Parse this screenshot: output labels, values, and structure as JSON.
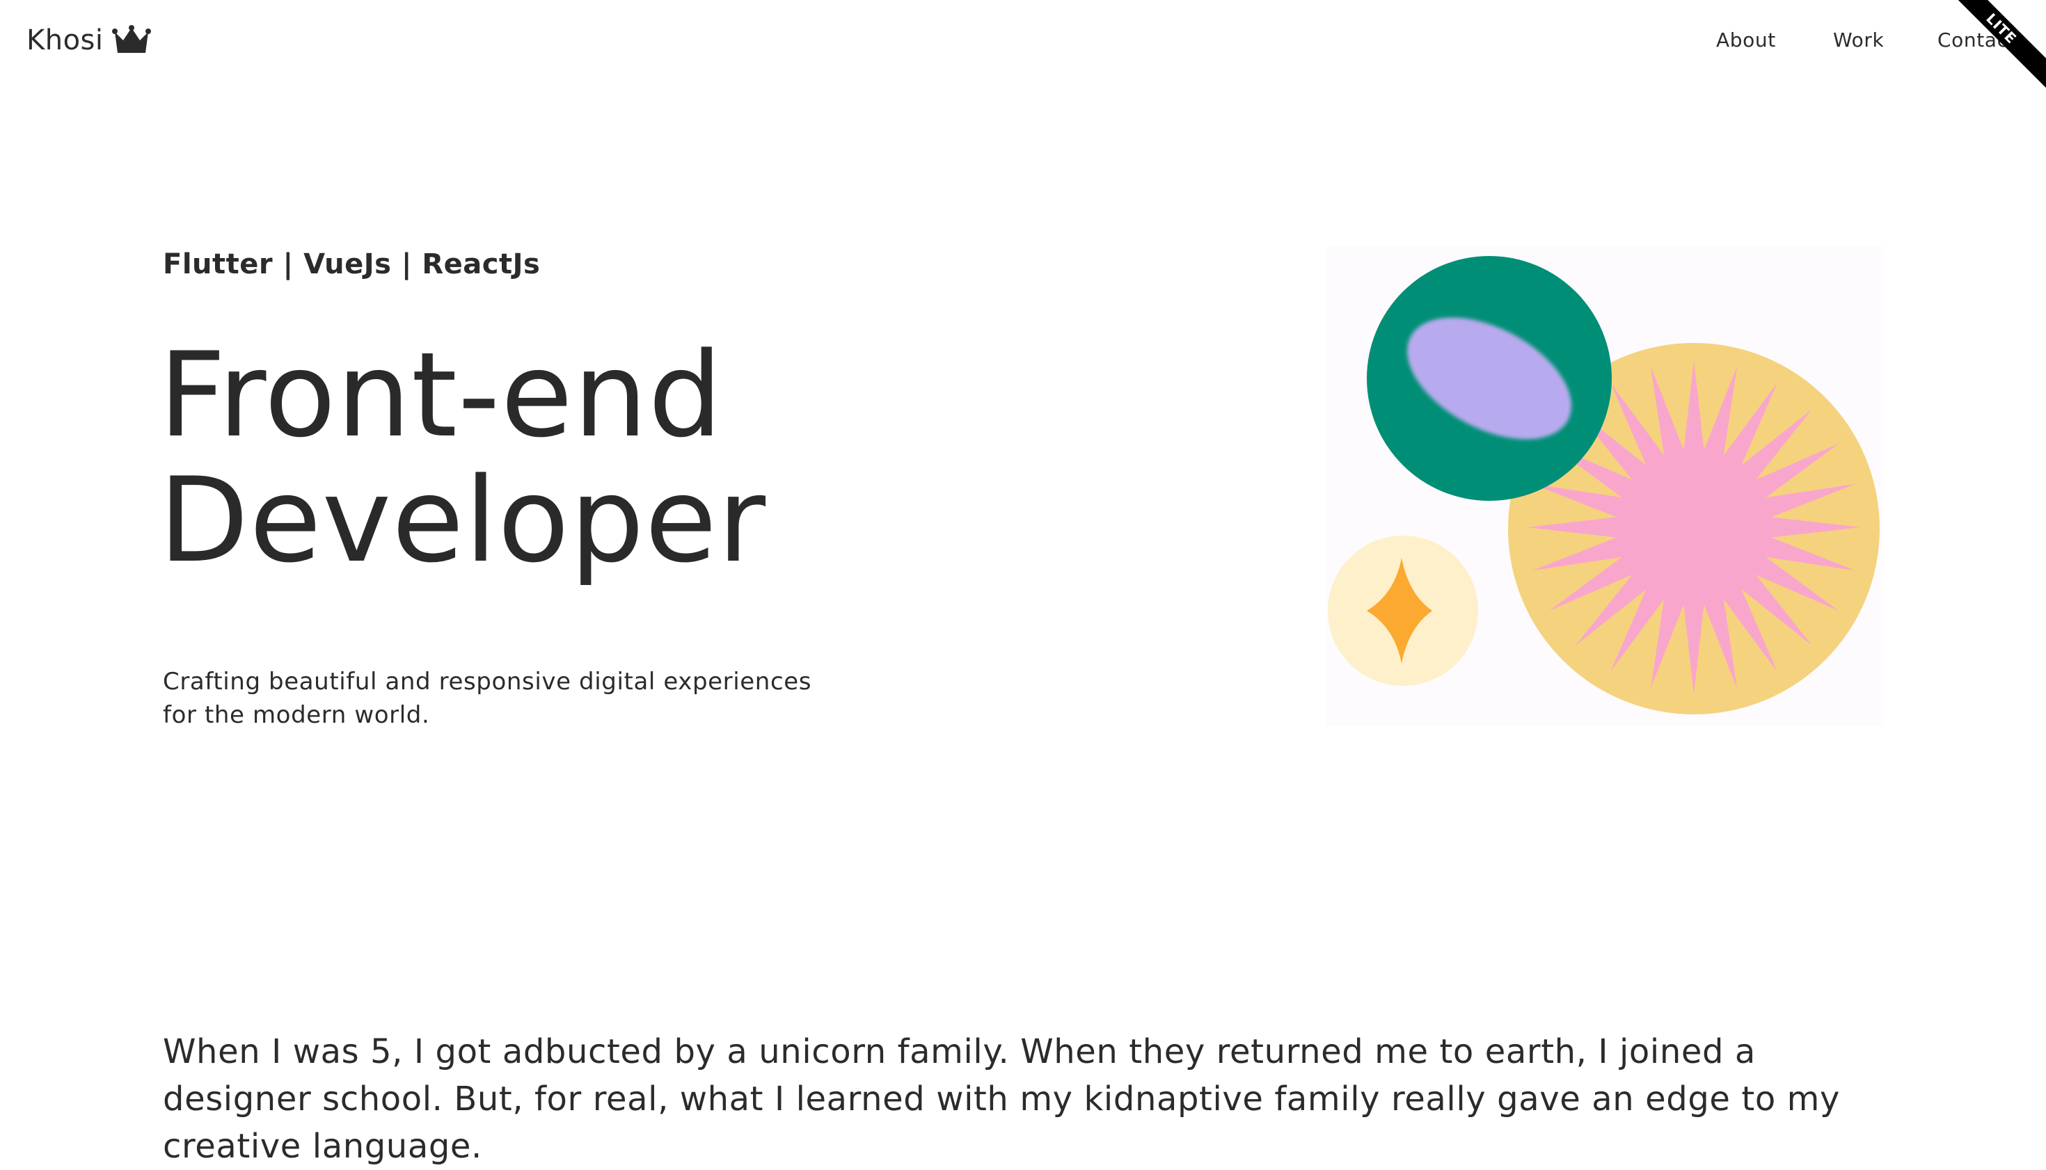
{
  "nav": {
    "brand": "Khosi",
    "brand_icon": "crown-icon",
    "links": [
      "About",
      "Work",
      "Contact"
    ],
    "ribbon": "LITE"
  },
  "hero": {
    "tags": "Flutter | VueJs | ReactJs",
    "title_line1": "Front-end",
    "title_line2": "Developer",
    "subtitle_line1": "Crafting beautiful and responsive digital experiences",
    "subtitle_line2": "for the modern world."
  },
  "about": {
    "text": "When I was 5, I got adbucted by a unicorn family. When they returned me to earth, I joined a designer school. But, for real, what I learned with my kidnaptive family really gave an edge to my creative language."
  },
  "colors": {
    "text": "#2b2b2b",
    "green": "#008f76",
    "lavender": "#b8aaee",
    "yellow": "#f5d27d",
    "pink": "#f9a6cd",
    "cream": "#fdf0ca",
    "orange": "#fba930"
  }
}
